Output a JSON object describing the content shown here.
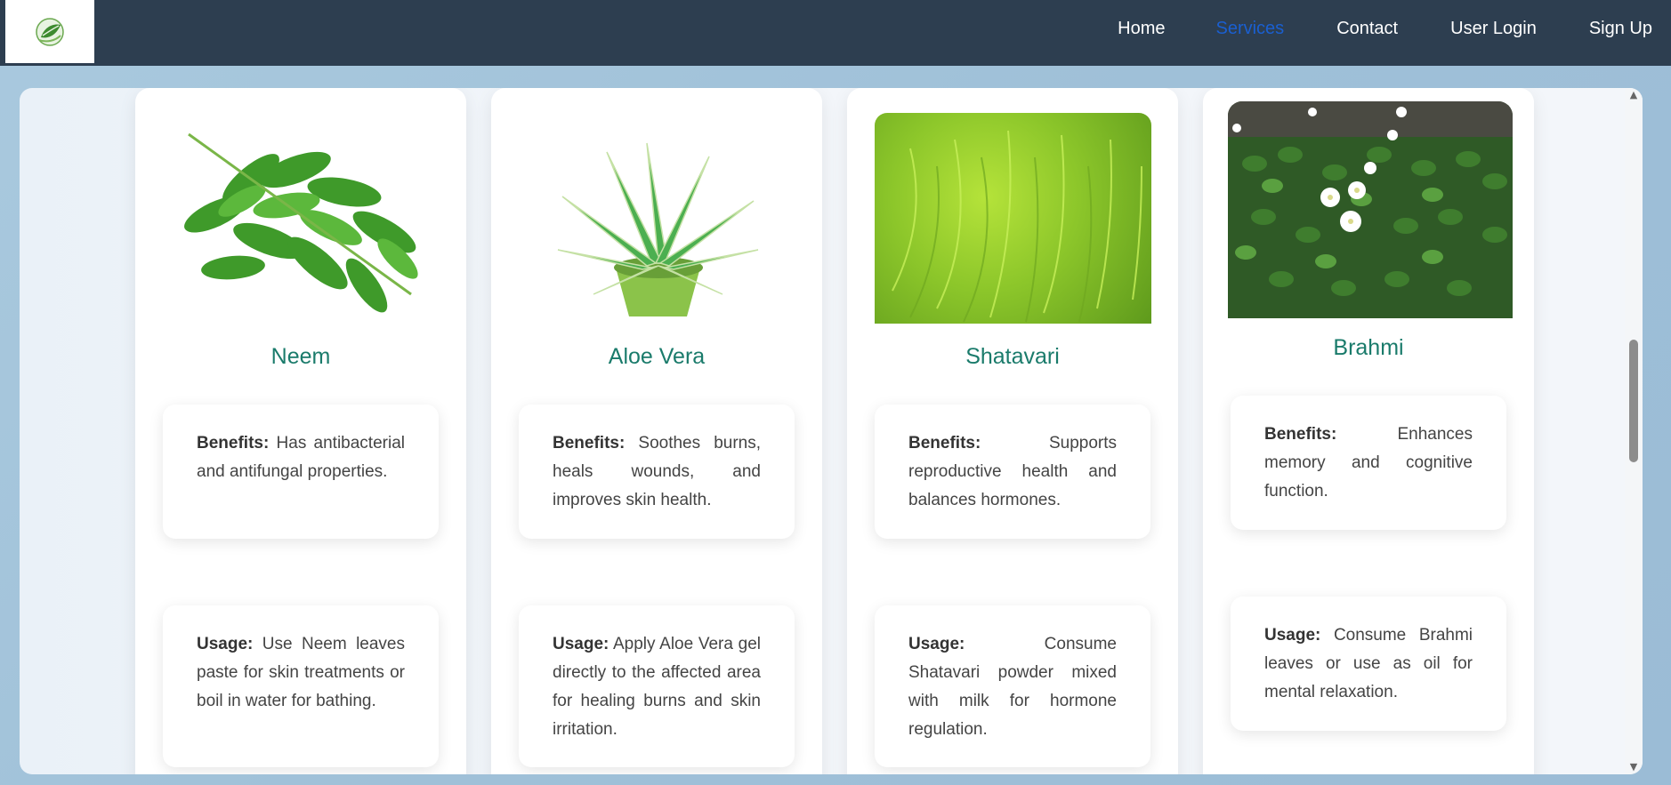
{
  "nav": {
    "logo": "leaf-logo-icon",
    "links": [
      {
        "label": "Home",
        "active": false
      },
      {
        "label": "Services",
        "active": true
      },
      {
        "label": "Contact",
        "active": false
      },
      {
        "label": "User Login",
        "active": false
      },
      {
        "label": "Sign Up",
        "active": false
      }
    ]
  },
  "colors": {
    "navbar_bg": "#2d3e50",
    "active_link": "#1a5fd0",
    "plant_name": "#1a7b6b"
  },
  "cards": [
    {
      "name": "Neem",
      "image": "neem-leaves-image",
      "benefits_label": "Benefits:",
      "benefits": "Has antibacterial and antifungal properties.",
      "usage_label": "Usage:",
      "usage": "Use Neem leaves paste for skin treatments or boil in water for bathing."
    },
    {
      "name": "Aloe Vera",
      "image": "aloe-vera-plant-image",
      "benefits_label": "Benefits:",
      "benefits": "Soothes burns, heals wounds, and improves skin health.",
      "usage_label": "Usage:",
      "usage": "Apply Aloe Vera gel directly to the affected area for healing burns and skin irritation."
    },
    {
      "name": "Shatavari",
      "image": "shatavari-plant-image",
      "benefits_label": "Benefits:",
      "benefits": "Supports reproductive health and balances hormones.",
      "usage_label": "Usage:",
      "usage": "Consume Shatavari powder mixed with milk for hormone regulation."
    },
    {
      "name": "Brahmi",
      "image": "brahmi-plant-image",
      "benefits_label": "Benefits:",
      "benefits": "Enhances memory and cognitive function.",
      "usage_label": "Usage:",
      "usage": "Consume Brahmi leaves or use as oil for mental relaxation."
    }
  ]
}
